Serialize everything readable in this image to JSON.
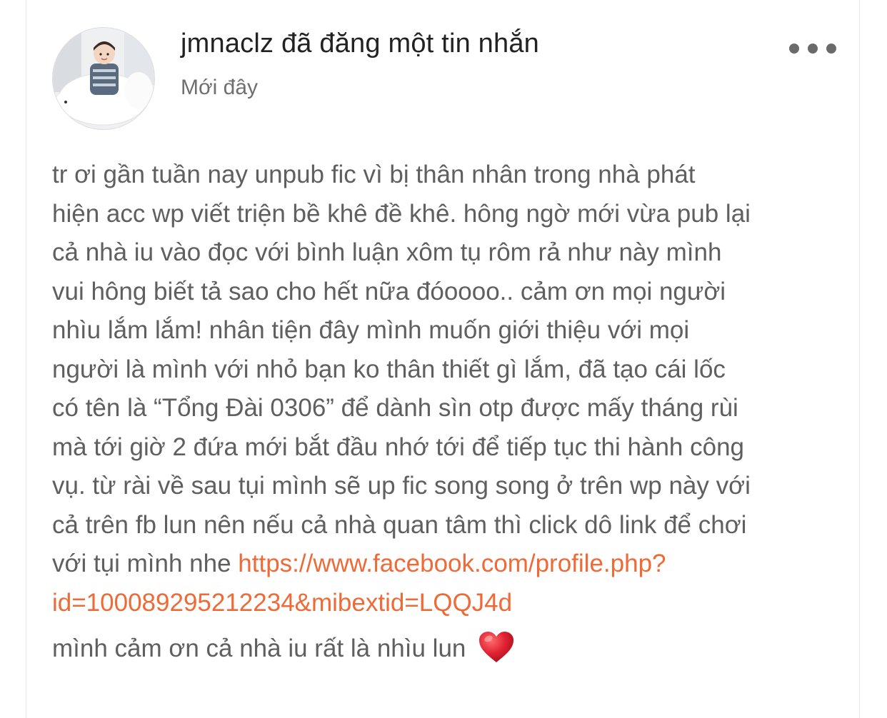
{
  "post": {
    "title": "jmnaclz đã đăng một tin nhắn",
    "timestamp": "Mới đây",
    "more_menu_icon": "more-horizontal-icon",
    "avatar_icon": "user-avatar",
    "body_lines": {
      "l1": "tr ơi gần tuần nay unpub fic vì bị thân nhân trong nhà phát",
      "l2": "hiện acc wp viết triện bề khê đề khê. hông ngờ mới vừa pub lại",
      "l3": "cả nhà iu vào đọc với bình luận xôm tụ rôm rả như này mình",
      "l4": "vui hông biết tả sao cho hết nữa đóoooo..  cảm ơn mọi người",
      "l5": "nhìu lắm lắm! nhân tiện đây mình muốn giới thiệu với mọi",
      "l6": "người là mình với nhỏ bạn ko thân thiết gì lắm, đã tạo cái lốc",
      "l7": "có tên là “Tổng Đài 0306” để dành sìn otp được mấy tháng rùi",
      "l8": "mà tới giờ 2 đứa mới bắt đầu nhớ tới để tiếp tục thi hành công",
      "l9": "vụ. từ rài về sau tụi mình sẽ up fic song song ở trên wp này với",
      "l10": "cả trên fb lun nên nếu cả nhà quan tâm thì click dô link để chơi",
      "l11_prefix": "với tụi mình nhe "
    },
    "link": {
      "part1": "https://www.facebook.com/profile.php?",
      "part2": "id=100089295212234&mibextid=LQQJ4d"
    },
    "closing": "mình cảm ơn cả nhà iu rất là nhìu lun",
    "closing_emoji": "heart-emoji",
    "colors": {
      "link": "#ee6a37",
      "body_text": "#5f5f5f",
      "title_text": "#222222",
      "timestamp_text": "#6f6f6f",
      "heart": "#d81e2c"
    }
  }
}
